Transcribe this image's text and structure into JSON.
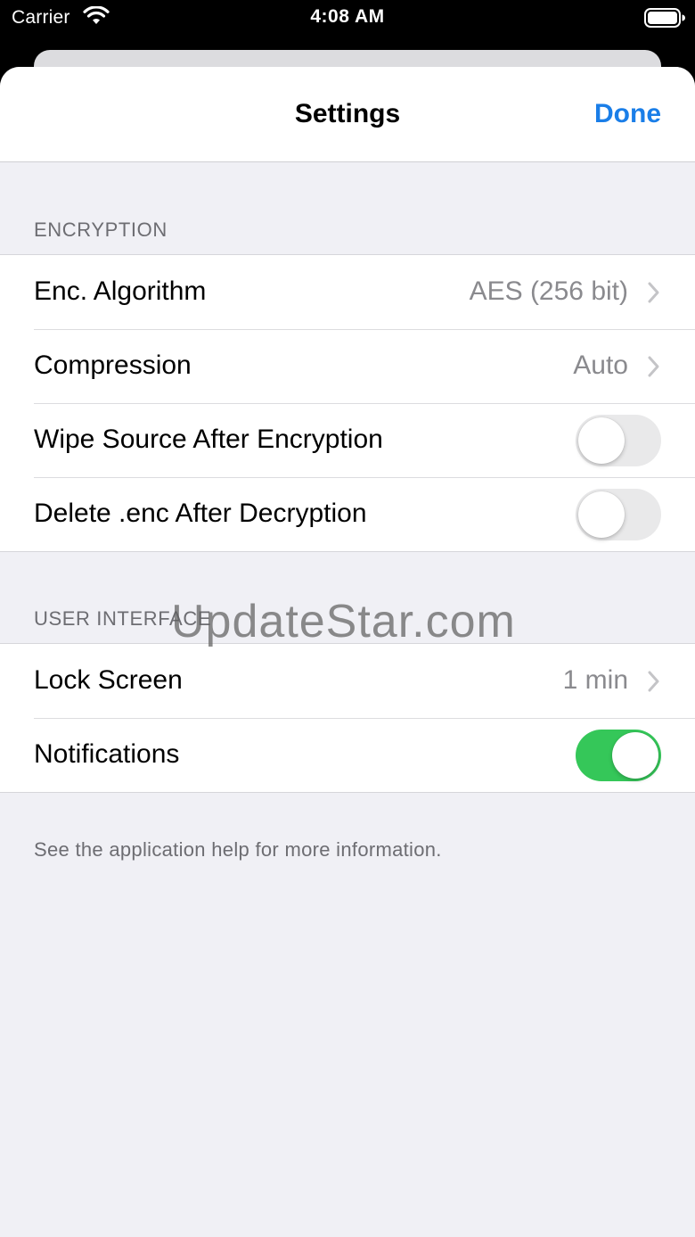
{
  "status_bar": {
    "carrier": "Carrier",
    "time": "4:08 AM",
    "icons": [
      "wifi-icon",
      "battery-icon"
    ]
  },
  "nav": {
    "title": "Settings",
    "done_label": "Done",
    "accent_color": "#1a7ee8"
  },
  "sections": {
    "encryption": {
      "header": "ENCRYPTION",
      "rows": [
        {
          "label": "Enc. Algorithm",
          "value": "AES (256 bit)",
          "control": "chevron"
        },
        {
          "label": "Compression",
          "value": "Auto",
          "control": "chevron"
        },
        {
          "label": "Wipe Source After Encryption",
          "control": "toggle",
          "on": false
        },
        {
          "label": "Delete .enc After Decryption",
          "control": "toggle",
          "on": false
        }
      ]
    },
    "user_interface": {
      "header": "USER INTERFACE",
      "rows": [
        {
          "label": "Lock Screen",
          "value": "1 min",
          "control": "chevron"
        },
        {
          "label": "Notifications",
          "control": "toggle",
          "on": true
        }
      ]
    }
  },
  "footer": "See the application help for more information.",
  "watermark": "UpdateStar.com",
  "colors": {
    "toggle_on": "#35c759",
    "toggle_off": "#e9e9ea",
    "background": "#f0f0f5"
  }
}
